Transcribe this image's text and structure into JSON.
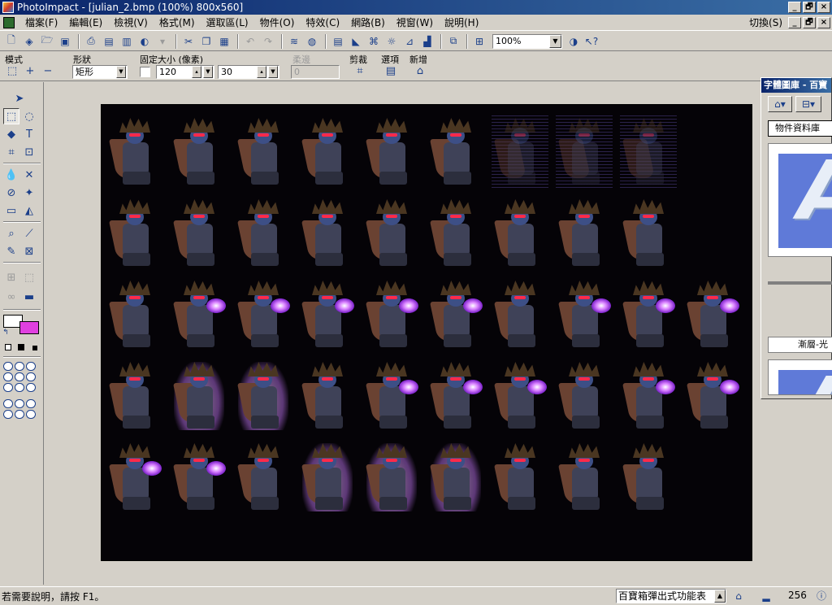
{
  "window": {
    "title": "PhotoImpact - [julian_2.bmp (100%) 800x560]",
    "minimize": "_",
    "maximize": "□",
    "close": "×",
    "restore": "🗗"
  },
  "menu": {
    "items": [
      "檔案(F)",
      "編輯(E)",
      "檢視(V)",
      "格式(M)",
      "選取區(L)",
      "物件(O)",
      "特效(C)",
      "網路(B)",
      "視窗(W)",
      "說明(H)"
    ],
    "switch_label": "切換(S)"
  },
  "toolbar": {
    "zoom": "100%",
    "icons": [
      "new-icon",
      "open-icon",
      "open-folder-icon",
      "save-icon",
      "print-icon",
      "print-preview-icon",
      "scan-icon",
      "web-icon",
      "cut-icon",
      "copy-icon",
      "paste-icon",
      "undo-icon",
      "redo-icon",
      "layer-icon",
      "mask-icon",
      "document-icon",
      "fill-icon",
      "filter-icon",
      "brightness-icon",
      "levels-icon",
      "histogram-icon",
      "browser-icon",
      "grid-icon",
      "web-preview-icon",
      "help-pointer-icon"
    ]
  },
  "attributes": {
    "mode_label": "模式",
    "shape_label": "形狀",
    "shape_value": "矩形",
    "fixed_size_label": "固定大小 (像素)",
    "width": "120",
    "height": "30",
    "soft_edge_label": "柔邊",
    "soft_edge_value": "0",
    "crop_label": "剪裁",
    "options_label": "選項",
    "new_label": "新增"
  },
  "library_panel": {
    "title": "字體圖庫 - 百寶",
    "dropdown": "物件資料庫",
    "thumb_letter": "A",
    "caption": "漸層-光"
  },
  "status": {
    "help_text": "若需要說明，請按 F1。",
    "combo": "百寶箱彈出式功能表",
    "number": "256"
  },
  "colors": {
    "foreground": "#ffffff",
    "background": "#e040e0",
    "titlebar": "#0a246a"
  }
}
